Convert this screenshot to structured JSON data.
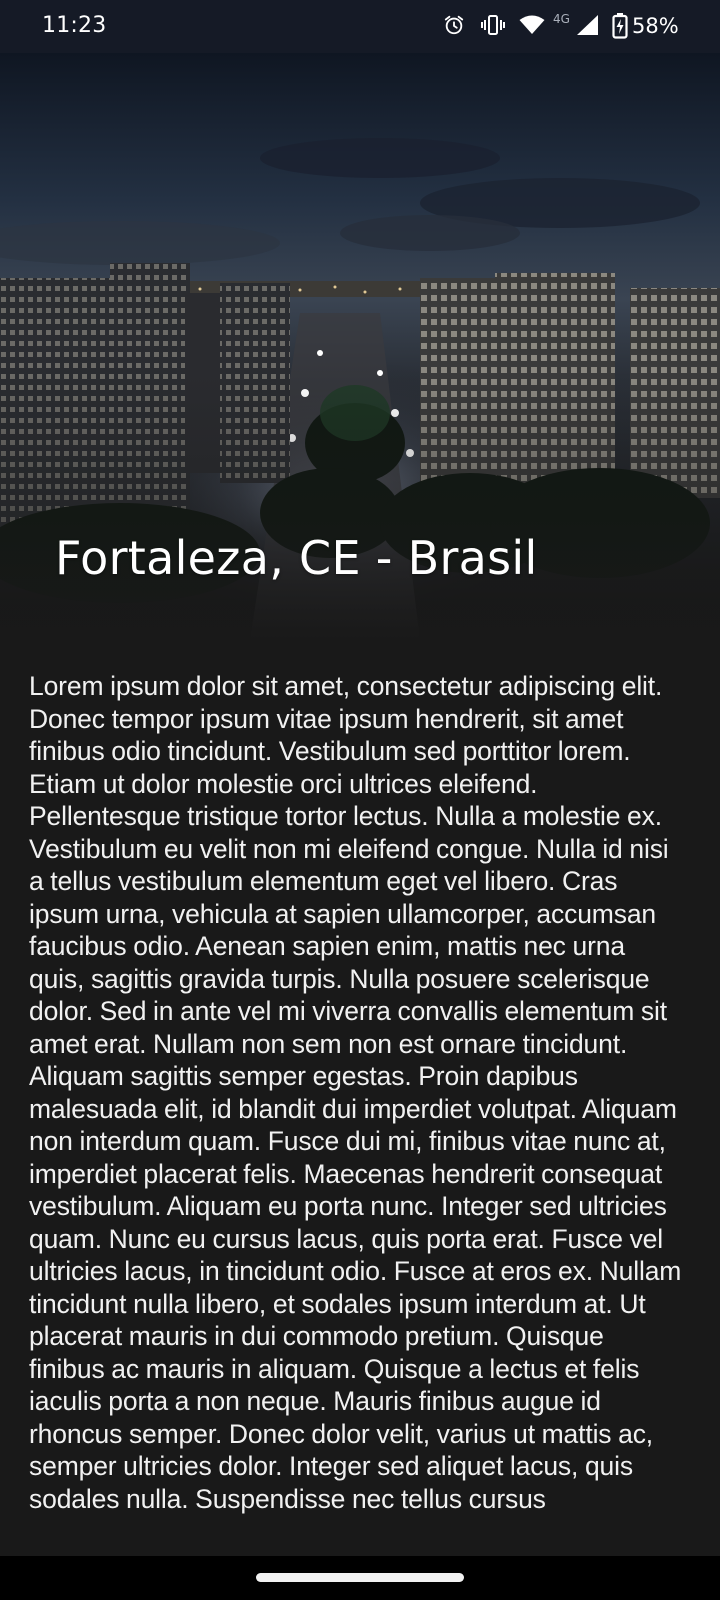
{
  "status_bar": {
    "time": "11:23",
    "network_type": "4G",
    "battery": "58%",
    "icons": [
      "alarm-icon",
      "vibrate-icon",
      "wifi-icon",
      "cell-signal-icon",
      "battery-charging-icon"
    ]
  },
  "hero": {
    "image": "night-cityscape-photo",
    "title": "Fortaleza, CE - Brasil"
  },
  "content": {
    "body": "Lorem ipsum dolor sit amet, consectetur adipiscing elit. Donec tempor ipsum vitae ipsum hendrerit, sit amet finibus odio tincidunt. Vestibulum sed porttitor lorem. Etiam ut dolor molestie orci ultrices eleifend. Pellentesque tristique tortor lectus. Nulla a molestie ex. Vestibulum eu velit non mi eleifend congue. Nulla id nisi a tellus vestibulum elementum eget vel libero. Cras ipsum urna, vehicula at sapien ullamcorper, accumsan faucibus odio. Aenean sapien enim, mattis nec urna quis, sagittis gravida turpis. Nulla posuere scelerisque dolor. Sed in ante vel mi viverra convallis elementum sit amet erat. Nullam non sem non est ornare tincidunt. Aliquam sagittis semper egestas. Proin dapibus malesuada elit, id blandit dui imperdiet volutpat. Aliquam non interdum quam. Fusce dui mi, finibus vitae nunc at, imperdiet placerat felis. Maecenas hendrerit consequat vestibulum. Aliquam eu porta nunc. Integer sed ultricies quam. Nunc eu cursus lacus, quis porta erat. Fusce vel ultricies lacus, in tincidunt odio. Fusce at eros ex. Nullam tincidunt nulla libero, et sodales ipsum interdum at. Ut placerat mauris in dui commodo pretium. Quisque finibus ac mauris in aliquam. Quisque a lectus et felis iaculis porta a non neque. Mauris finibus augue id rhoncus semper. Donec dolor velit, varius ut mattis ac, semper ultricies dolor. Integer sed aliquet lacus, quis sodales nulla. Suspendisse nec tellus cursus"
  },
  "colors": {
    "status_bar_bg": "#151a26",
    "content_bg": "#191919",
    "text": "#f1f1f1"
  }
}
